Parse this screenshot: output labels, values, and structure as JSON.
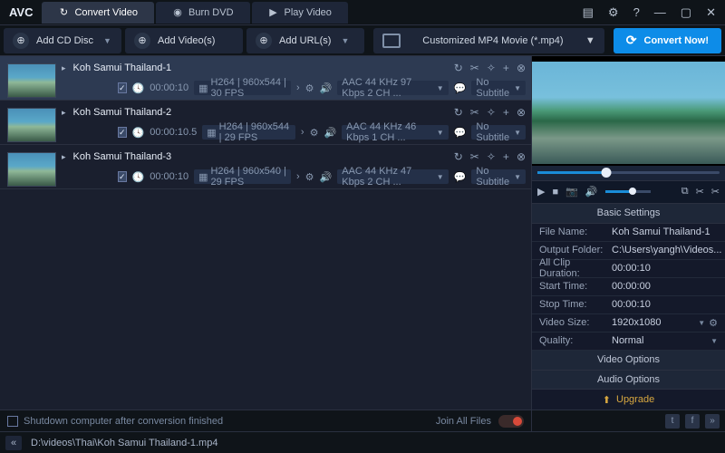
{
  "app": {
    "logo": "AVC"
  },
  "tabs": [
    {
      "label": "Convert Video",
      "icon": "↻"
    },
    {
      "label": "Burn DVD",
      "icon": "◉"
    },
    {
      "label": "Play Video",
      "icon": "▶"
    }
  ],
  "toolbar": {
    "add_cd": "Add CD Disc",
    "add_videos": "Add Video(s)",
    "add_urls": "Add URL(s)",
    "preset": "Customized MP4 Movie (*.mp4)",
    "convert": "Convert Now!"
  },
  "files": [
    {
      "title": "Koh Samui Thailand-1",
      "duration": "00:00:10",
      "codec": "H264 | 960x544 | 30 FPS",
      "audio": "AAC 44 KHz 97 Kbps 2 CH ...",
      "subtitle": "No Subtitle"
    },
    {
      "title": "Koh Samui Thailand-2",
      "duration": "00:00:10.5",
      "codec": "H264 | 960x544 | 29 FPS",
      "audio": "AAC 44 KHz 46 Kbps 1 CH ...",
      "subtitle": "No Subtitle"
    },
    {
      "title": "Koh Samui Thailand-3",
      "duration": "00:00:10",
      "codec": "H264 | 960x540 | 29 FPS",
      "audio": "AAC 44 KHz 47 Kbps 2 CH ...",
      "subtitle": "No Subtitle"
    }
  ],
  "footer": {
    "shutdown": "Shutdown computer after conversion finished",
    "join": "Join All Files"
  },
  "path": "D:\\videos\\Thai\\Koh Samui Thailand-1.mp4",
  "panel": {
    "basic_heading": "Basic Settings",
    "rows": {
      "file_name_k": "File Name:",
      "file_name_v": "Koh Samui Thailand-1",
      "output_k": "Output Folder:",
      "output_v": "C:\\Users\\yangh\\Videos...",
      "clip_k": "All Clip Duration:",
      "clip_v": "00:00:10",
      "start_k": "Start Time:",
      "start_v": "00:00:00",
      "stop_k": "Stop Time:",
      "stop_v": "00:00:10",
      "size_k": "Video Size:",
      "size_v": "1920x1080",
      "quality_k": "Quality:",
      "quality_v": "Normal"
    },
    "video_options": "Video Options",
    "audio_options": "Audio Options",
    "upgrade": "Upgrade"
  }
}
